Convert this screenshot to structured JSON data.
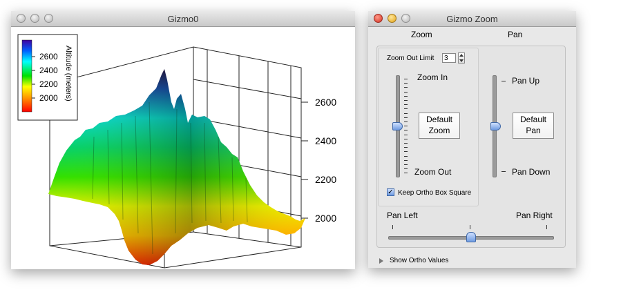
{
  "gizmo_window": {
    "title": "Gizmo0",
    "colorbar": {
      "label": "Altitude (meters)",
      "ticks": [
        "2600",
        "2400",
        "2200",
        "2000"
      ]
    },
    "z_axis_ticks": [
      "2600",
      "2400",
      "2200",
      "2000"
    ]
  },
  "zoom_window": {
    "title": "Gizmo Zoom",
    "zoom_header": "Zoom",
    "pan_header": "Pan",
    "zoom_out_limit_label": "Zoom Out Limit",
    "zoom_out_limit_value": "3",
    "zoom_in_label": "Zoom In",
    "zoom_out_label": "Zoom Out",
    "default_zoom_label": "Default\nZoom",
    "pan_up_label": "Pan Up",
    "pan_down_label": "Pan Down",
    "default_pan_label": "Default\nPan",
    "keep_ortho_label": "Keep Ortho Box Square",
    "keep_ortho_checked": true,
    "pan_left_label": "Pan Left",
    "pan_right_label": "Pan Right",
    "show_ortho_label": "Show Ortho Values",
    "zoom_slider_level": 0.5,
    "pan_vertical_level": 0.5,
    "pan_horizontal_level": 0.5
  }
}
